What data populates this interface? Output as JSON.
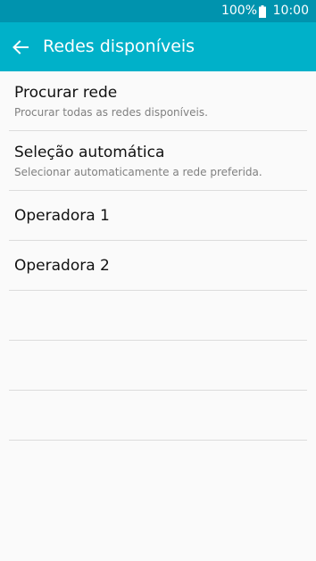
{
  "status_bar": {
    "battery": "100%",
    "time": "10:00",
    "battery_icon": "battery-full-icon"
  },
  "app_bar": {
    "title": "Redes disponíveis",
    "back_icon": "arrow-left-icon"
  },
  "items": [
    {
      "title": "Procurar rede",
      "subtitle": "Procurar todas as redes disponíveis."
    },
    {
      "title": "Seleção automática",
      "subtitle": "Selecionar automaticamente a rede preferida."
    },
    {
      "title": "Operadora 1"
    },
    {
      "title": "Operadora 2"
    }
  ],
  "colors": {
    "status_bar": "#0093ae",
    "app_bar": "#00b1c9",
    "background": "#fafafa",
    "divider": "#dcdcdc"
  }
}
